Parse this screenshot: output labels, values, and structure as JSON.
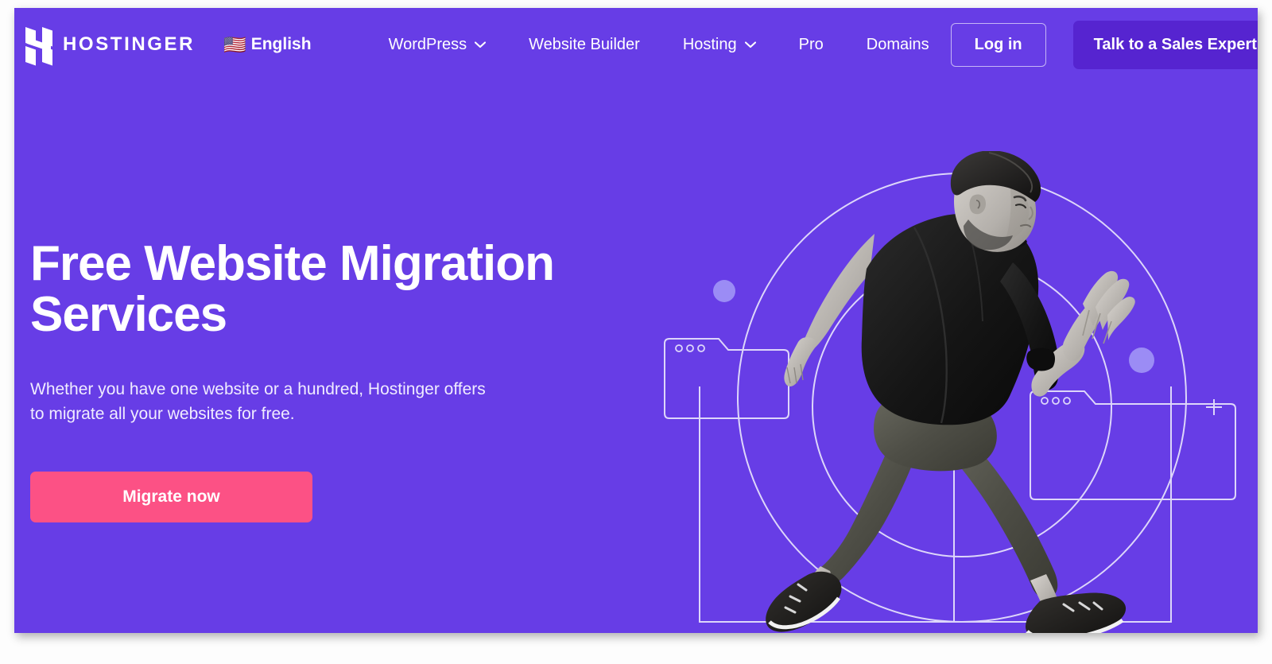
{
  "header": {
    "brand": {
      "name": "HOSTINGER",
      "logo_icon": "hostinger-h-logo"
    },
    "language": {
      "flag_icon": "us-flag-icon",
      "flag_glyph": "🇺🇸",
      "label": "English"
    },
    "nav": [
      {
        "label": "WordPress",
        "has_dropdown": true,
        "caret_icon": "chevron-down-icon"
      },
      {
        "label": "Website Builder",
        "has_dropdown": false
      },
      {
        "label": "Hosting",
        "has_dropdown": true,
        "caret_icon": "chevron-down-icon"
      },
      {
        "label": "Pro",
        "has_dropdown": false
      },
      {
        "label": "Domains",
        "has_dropdown": false
      }
    ],
    "login_label": "Log in",
    "sales_label": "Talk to a Sales Expert"
  },
  "hero": {
    "title": "Free Website Migration\nServices",
    "subtitle": "Whether you have one website or a hundred, Hostinger offers\nto migrate all your websites for free.",
    "cta_label": "Migrate now",
    "illustration": {
      "alt": "running-man-illustration",
      "elements": [
        "outer-circle-outline",
        "inner-circle-outline",
        "rectangle-frame",
        "left-browser-window",
        "right-browser-window",
        "accent-dot-left",
        "accent-dot-right",
        "plus-icon",
        "window-dots"
      ]
    }
  },
  "colors": {
    "background_purple": "#673de6",
    "sales_button_purple": "#5624d0",
    "cta_pink": "#fc5185",
    "accent_dot": "#9b8cf5",
    "line_art": "#e3ddfb",
    "text_white": "#ffffff"
  }
}
